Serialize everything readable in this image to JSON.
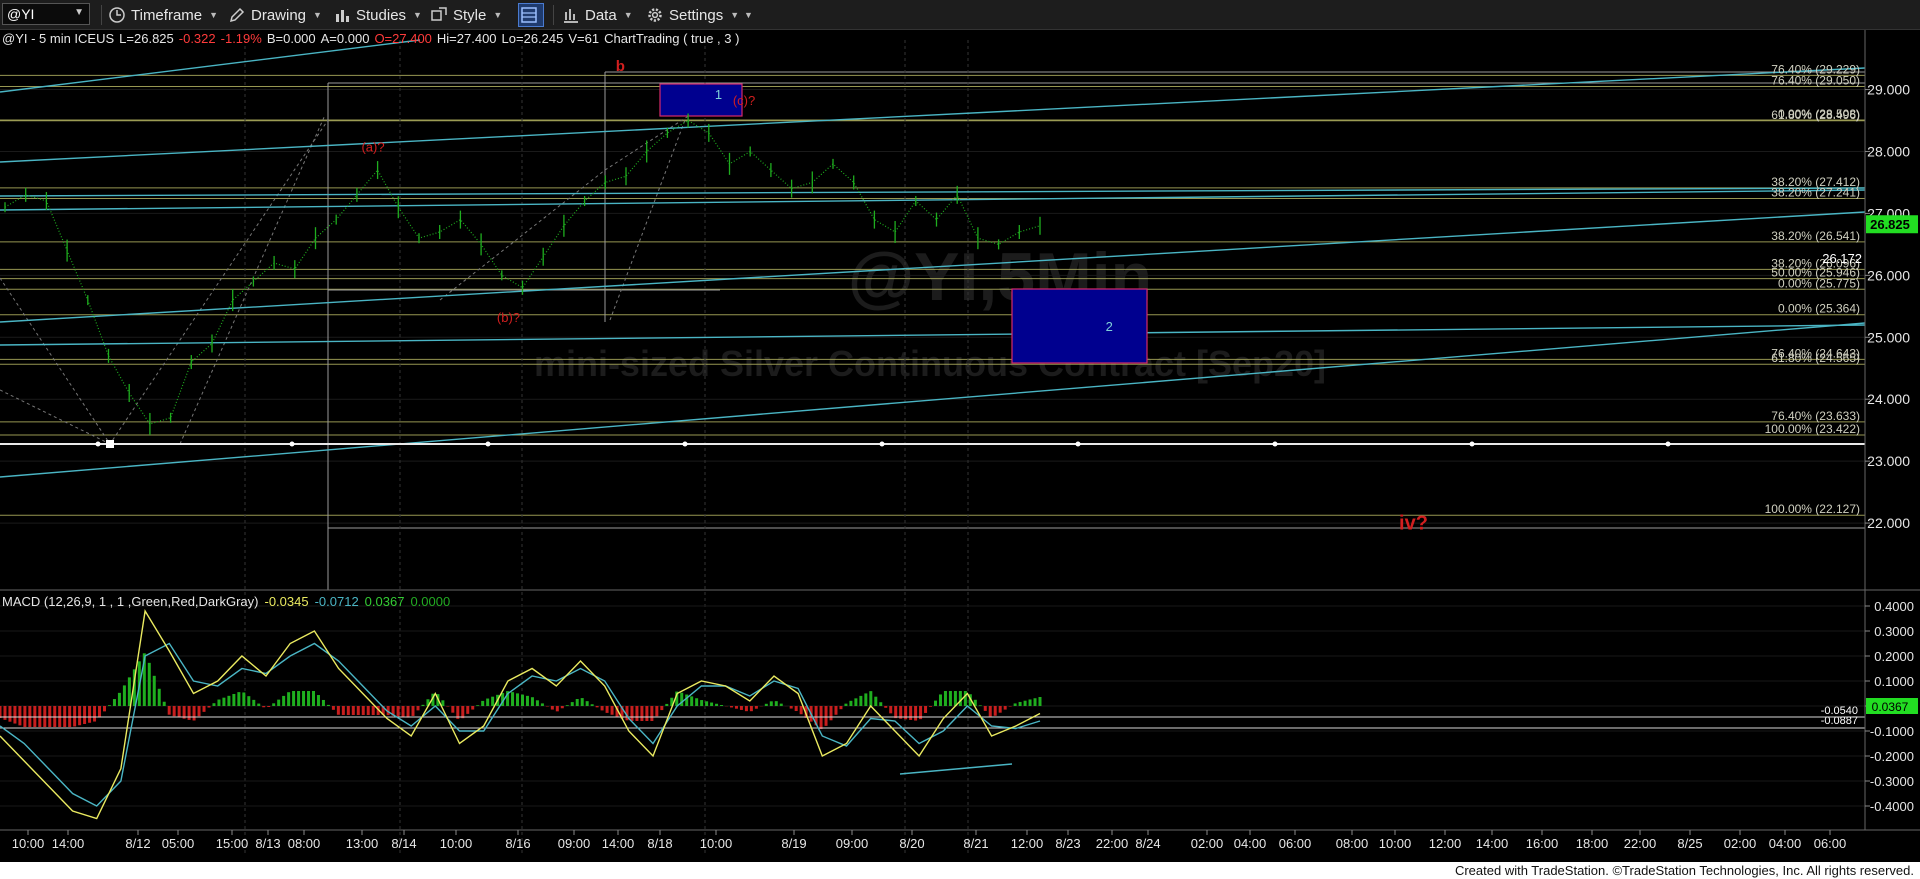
{
  "toolbar": {
    "symbol": "@YI",
    "timeframe": "Timeframe",
    "drawing": "Drawing",
    "studies": "Studies",
    "style": "Style",
    "data": "Data",
    "settings": "Settings"
  },
  "header": {
    "symbol_info": "@YI - 5 min  ICEUS",
    "last": "L=26.825",
    "change": "-0.322",
    "change_pct": "-1.19%",
    "bid": "B=0.000",
    "ask": "A=0.000",
    "open": "O=27.400",
    "high": "Hi=27.400",
    "low": "Lo=26.245",
    "volume": "V=61",
    "study": "ChartTrading ( true , 3 )"
  },
  "watermark": {
    "symbol": "@YI,5Min",
    "name": "mini-sized Silver Continuous Contract [Sep20]"
  },
  "colors": {
    "up": "#1fae1f",
    "down": "#c81e1e",
    "trend": "#4ab5c4",
    "fib": "#b2b261",
    "wave_label": "#d21f1f",
    "last_badge": "#22dd22",
    "box": "#00008f"
  },
  "chart_data": [
    {
      "type": "line",
      "title": "@YI - 5 min",
      "ylim": [
        21.0,
        29.8
      ],
      "y_ticks": [
        22.0,
        23.0,
        24.0,
        25.0,
        26.0,
        27.0,
        28.0,
        29.0
      ],
      "y_tick_labels": [
        "22.000",
        "23.000",
        "24.000",
        "25.000",
        "26.000",
        "27.000",
        "28.000",
        "29.000"
      ],
      "x_tick_labels": [
        "10:00",
        "14:00",
        "8/12",
        "05:00",
        "15:00",
        "8/13",
        "08:00",
        "13:00",
        "8/14",
        "10:00",
        "8/16",
        "09:00",
        "14:00",
        "8/18",
        "10:00",
        "8/19",
        "09:00",
        "8/20",
        "8/21",
        "12:00",
        "8/23",
        "22:00",
        "8/24",
        "02:00",
        "04:00",
        "06:00",
        "08:00",
        "10:00",
        "12:00",
        "14:00",
        "16:00",
        "18:00",
        "22:00",
        "8/25",
        "02:00",
        "04:00",
        "06:00"
      ],
      "last_value": 26.825,
      "last_label": "26.825",
      "price_label": "26.172",
      "series": [
        {
          "values": [
            27.1,
            27.3,
            27.2,
            26.4,
            25.6,
            24.7,
            24.1,
            23.6,
            23.7,
            24.6,
            24.9,
            25.6,
            25.9,
            26.2,
            26.1,
            26.6,
            26.9,
            27.3,
            27.7,
            27.1,
            26.6,
            26.7,
            26.9,
            26.5,
            26.0,
            25.8,
            26.3,
            26.8,
            27.2,
            27.5,
            27.6,
            28.0,
            28.3,
            28.5,
            28.3,
            27.8,
            28.0,
            27.7,
            27.4,
            27.5,
            27.8,
            27.5,
            26.9,
            26.7,
            27.2,
            26.9,
            27.3,
            26.6,
            26.5,
            26.7,
            26.8
          ]
        }
      ],
      "fib_levels": [
        {
          "label": "76.40% (29.229)",
          "value": 29.229
        },
        {
          "label": "76.40% (29.050)",
          "value": 29.05
        },
        {
          "label": "0.00% (28.508)",
          "value": 28.508
        },
        {
          "label": "61.80% (28.496)",
          "value": 28.496
        },
        {
          "label": "38.20% (27.412)",
          "value": 27.412
        },
        {
          "label": "38.20% (27.241)",
          "value": 27.241
        },
        {
          "label": "38.20% (26.541)",
          "value": 26.541
        },
        {
          "label": "38.20% (26.096)",
          "value": 26.096
        },
        {
          "label": "50.00% (25.946)",
          "value": 25.946
        },
        {
          "label": "0.00% (25.775)",
          "value": 25.775
        },
        {
          "label": "0.00% (25.364)",
          "value": 25.364
        },
        {
          "label": "76.40% (24.643)",
          "value": 24.643
        },
        {
          "label": "61.80% (24.565)",
          "value": 24.565
        },
        {
          "label": "76.40% (23.633)",
          "value": 23.633
        },
        {
          "label": "100.00% (23.422)",
          "value": 23.422
        },
        {
          "label": "100.00% (22.127)",
          "value": 22.127
        }
      ],
      "annotations": [
        {
          "text": "b",
          "x": 0.316,
          "y": 29.3
        },
        {
          "text": "1",
          "x": 0.366,
          "y": 28.85
        },
        {
          "text": "(c)?",
          "x": 0.379,
          "y": 28.75
        },
        {
          "text": "(a)?",
          "x": 0.19,
          "y": 28.0
        },
        {
          "text": "(b)?",
          "x": 0.259,
          "y": 25.25
        },
        {
          "text": "2",
          "x": 0.565,
          "y": 25.1
        },
        {
          "text": "iv?",
          "x": 0.72,
          "y": 21.9
        }
      ]
    },
    {
      "type": "line",
      "title": "MACD (12,26,9, 1 , 1 ,Green,Red,DarkGray)",
      "header_values": [
        "-0.0345",
        "-0.0712",
        "0.0367",
        "0.0000"
      ],
      "ylim": [
        -0.48,
        0.44
      ],
      "y_ticks": [
        0.4,
        0.3,
        0.2,
        0.1,
        0.0,
        -0.1,
        -0.2,
        -0.3,
        -0.4
      ],
      "y_tick_labels": [
        "0.4000",
        "0.3000",
        "0.2000",
        "0.1000",
        "0.0000",
        "-0.1000",
        "-0.2000",
        "-0.3000",
        "-0.4000"
      ],
      "last_label": "0.0367",
      "level_labels": [
        "-0.0540",
        "-0.0887"
      ],
      "series": [
        {
          "name": "MACD",
          "values": [
            -0.12,
            -0.22,
            -0.32,
            -0.42,
            -0.45,
            -0.25,
            0.38,
            0.22,
            0.05,
            0.1,
            0.2,
            0.12,
            0.25,
            0.3,
            0.15,
            0.05,
            -0.05,
            -0.12,
            0.05,
            -0.15,
            -0.08,
            0.1,
            0.15,
            0.08,
            0.18,
            0.08,
            -0.1,
            -0.2,
            0.05,
            0.1,
            0.08,
            0.02,
            0.12,
            0.05,
            -0.2,
            -0.15,
            0.0,
            -0.1,
            -0.2,
            -0.05,
            0.05,
            -0.12,
            -0.08,
            -0.03
          ]
        },
        {
          "name": "Signal",
          "values": [
            -0.08,
            -0.15,
            -0.25,
            -0.35,
            -0.4,
            -0.3,
            0.2,
            0.25,
            0.1,
            0.08,
            0.15,
            0.13,
            0.2,
            0.25,
            0.18,
            0.08,
            -0.02,
            -0.08,
            0.0,
            -0.1,
            -0.1,
            0.05,
            0.12,
            0.1,
            0.15,
            0.1,
            -0.05,
            -0.15,
            0.0,
            0.08,
            0.08,
            0.04,
            0.1,
            0.07,
            -0.12,
            -0.16,
            -0.05,
            -0.06,
            -0.15,
            -0.1,
            0.0,
            -0.08,
            -0.09,
            -0.06
          ]
        }
      ]
    }
  ],
  "footer": {
    "credit": "Created with TradeStation. ©TradeStation Technologies, Inc. All rights reserved."
  }
}
